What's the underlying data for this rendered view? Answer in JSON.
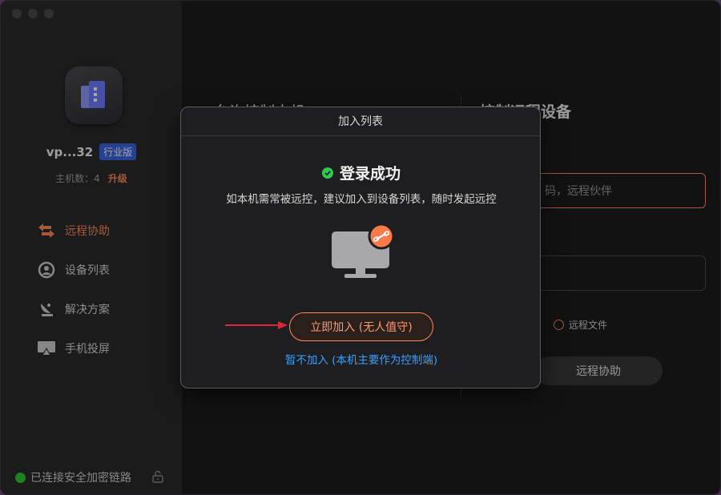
{
  "sidebar": {
    "username": "vp...32",
    "edition_badge": "行业版",
    "host_count": "主机数：4",
    "upgrade": "升级",
    "nav": [
      {
        "label": "远程协助",
        "icon": "swap-arrows-icon",
        "active": true
      },
      {
        "label": "设备列表",
        "icon": "device-list-icon",
        "active": false
      },
      {
        "label": "解决方案",
        "icon": "satellite-dish-icon",
        "active": false
      },
      {
        "label": "手机投屏",
        "icon": "screen-cast-icon",
        "active": false
      }
    ],
    "status": "已连接安全加密链路",
    "status_color": "#2ec92e"
  },
  "main": {
    "left_heading": "允许控制本机",
    "right_heading": "控制远程设备",
    "remote_input_placeholder": "码，远程伙伴",
    "radio_label": "远程文件",
    "assist_button": "远程协助"
  },
  "modal": {
    "title": "加入列表",
    "success": "登录成功",
    "description": "如本机需常被远控，建议加入到设备列表，随时发起远控",
    "join_button": "立即加入 (无人值守)",
    "skip_link": "暂不加入 (本机主要作为控制端)"
  },
  "colors": {
    "accent": "#ff8a5c",
    "link": "#3aa0ff",
    "success": "#2ec94e",
    "badge": "#3b63e0",
    "arrow": "#e0243a"
  }
}
